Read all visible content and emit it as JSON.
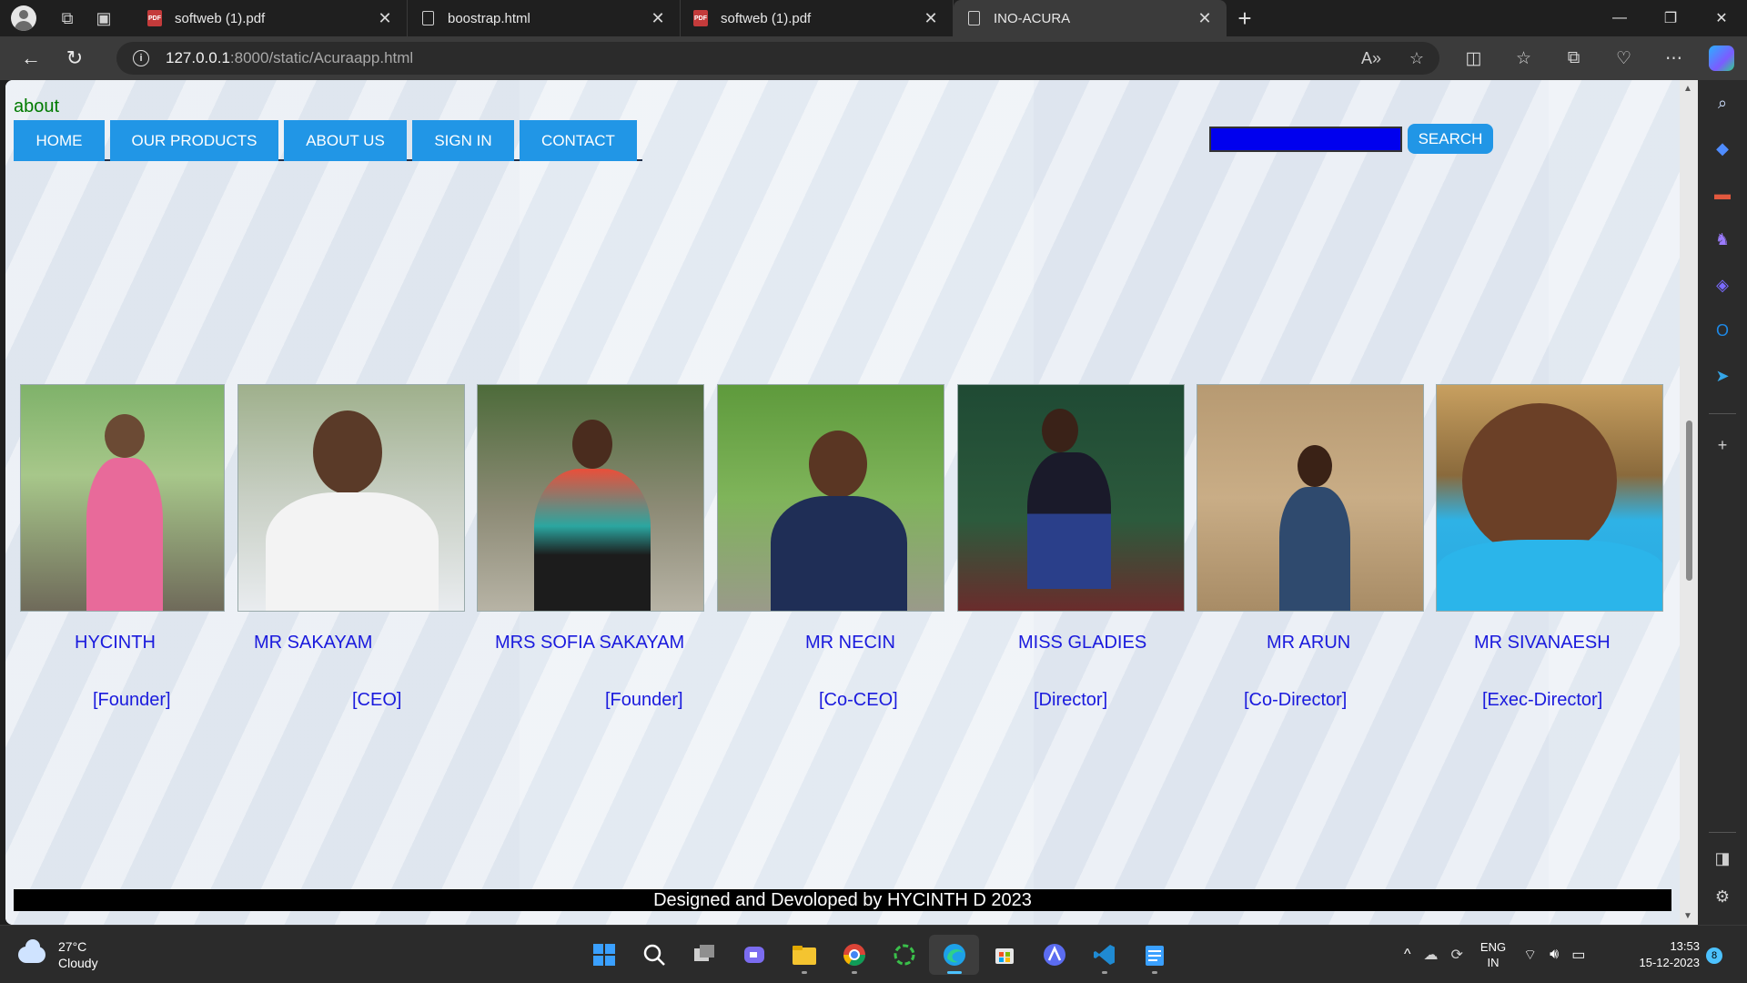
{
  "browser": {
    "tabs": [
      {
        "label": "softweb (1).pdf",
        "type": "pdf"
      },
      {
        "label": "boostrap.html",
        "type": "doc"
      },
      {
        "label": "softweb (1).pdf",
        "type": "pdf"
      },
      {
        "label": "INO-ACURA",
        "type": "doc",
        "active": true
      }
    ],
    "url_host": "127.0.0.1",
    "url_path": ":8000/static/Acuraapp.html"
  },
  "page": {
    "about_link": "about",
    "menu": [
      "HOME",
      "OUR PRODUCTS",
      "ABOUT US",
      "SIGN IN",
      "CONTACT"
    ],
    "search_button": "SEARCH",
    "search_box_color": "#0000ee",
    "accent_color": "#2196e6",
    "name_color": "#1a1add",
    "members": [
      {
        "name": "HYCINTH",
        "role": "[Founder]"
      },
      {
        "name": "MR SAKAYAM",
        "role": "[CEO]"
      },
      {
        "name": "MRS SOFIA SAKAYAM",
        "role": "[Founder]"
      },
      {
        "name": "MR NECIN",
        "role": "[Co-CEO]"
      },
      {
        "name": "MISS GLADIES",
        "role": "[Director]"
      },
      {
        "name": "MR ARUN",
        "role": "[Co-Director]"
      },
      {
        "name": "MR SIVANAESH",
        "role": "[Exec-Director]"
      }
    ],
    "footer": "Designed and Devoloped by HYCINTH D 2023"
  },
  "taskbar": {
    "weather_temp": "27°C",
    "weather_desc": "Cloudy",
    "lang_top": "ENG",
    "lang_bottom": "IN",
    "time": "13:53",
    "date": "15-12-2023",
    "notification_count": "8"
  }
}
